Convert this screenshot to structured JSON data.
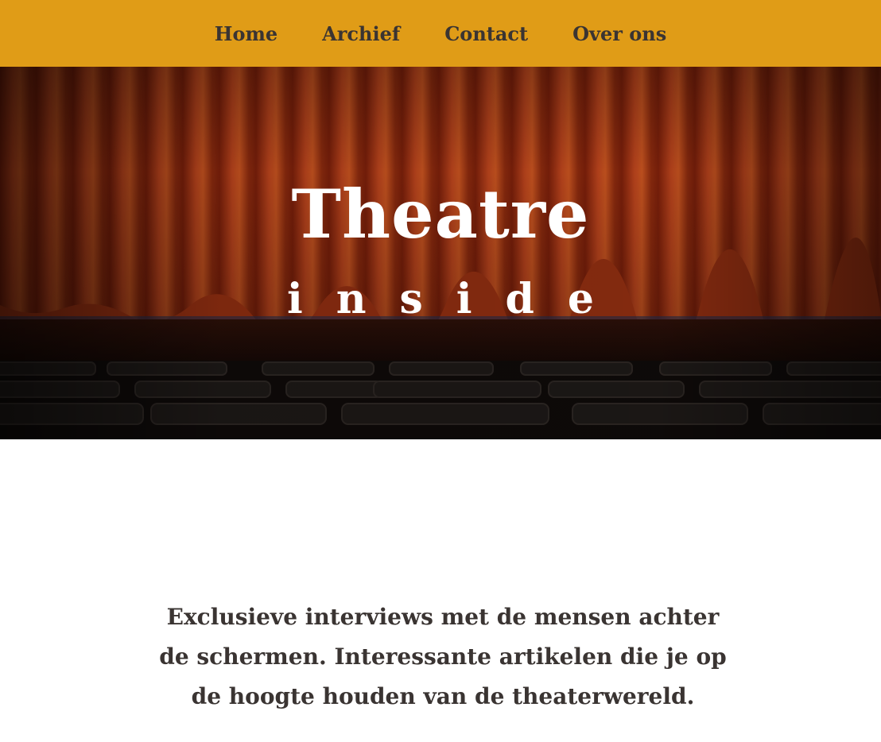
{
  "nav": {
    "items": [
      {
        "label": "Home"
      },
      {
        "label": "Archief"
      },
      {
        "label": "Contact"
      },
      {
        "label": "Over ons"
      }
    ]
  },
  "hero": {
    "title": "Theatre",
    "subtitle": "inside"
  },
  "intro": {
    "text": "Exclusieve interviews met de mensen achter de schermen. Interessante artikelen die je op de hoogte houden van de theaterwereld."
  },
  "colors": {
    "nav_background": "#e09c17",
    "nav_text": "#3a3432",
    "body_text": "#3a3432",
    "curtain": "#b3401a",
    "hero_text": "#ffffff"
  }
}
